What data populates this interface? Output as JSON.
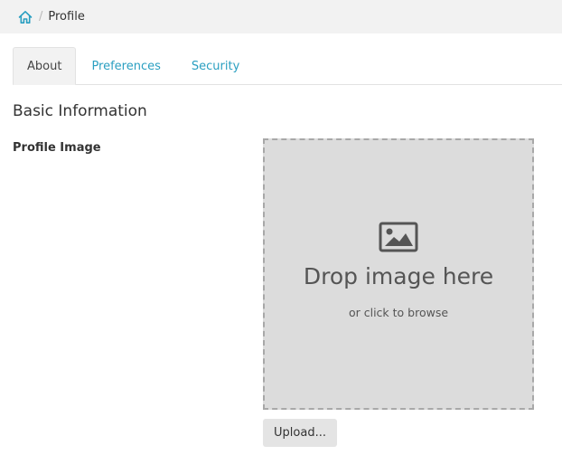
{
  "breadcrumb": {
    "home_icon": "home-icon",
    "separator": "/",
    "current": "Profile"
  },
  "tabs": [
    {
      "label": "About",
      "active": true
    },
    {
      "label": "Preferences",
      "active": false
    },
    {
      "label": "Security",
      "active": false
    }
  ],
  "section": {
    "title": "Basic Information"
  },
  "profile_image": {
    "label": "Profile Image",
    "icon": "image-icon",
    "drop_text": "Drop image here",
    "drop_subtext": "or click to browse",
    "upload_label": "Upload..."
  },
  "colors": {
    "accent": "#2a9fc1",
    "breadcrumb_bg": "#f2f2f2",
    "dropzone_bg": "#dcdcdc"
  }
}
